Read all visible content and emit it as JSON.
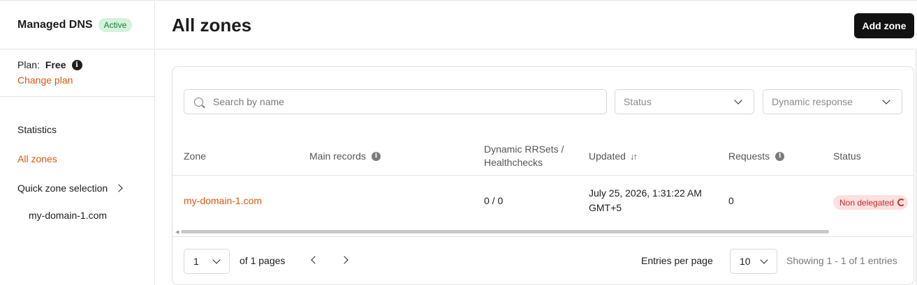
{
  "sidebar": {
    "title": "Managed DNS",
    "status_badge": "Active",
    "plan_label": "Plan:",
    "plan_value": "Free",
    "change_plan": "Change plan",
    "nav": [
      {
        "label": "Statistics"
      },
      {
        "label": "All zones"
      },
      {
        "label": "Quick zone selection"
      }
    ],
    "quick_zones": [
      "my-domain-1.com"
    ]
  },
  "header": {
    "title": "All zones",
    "add_button": "Add zone"
  },
  "filters": {
    "search_placeholder": "Search by name",
    "status_placeholder": "Status",
    "dynamic_placeholder": "Dynamic response"
  },
  "table": {
    "columns": {
      "zone": "Zone",
      "main_records": "Main records",
      "dynamic_line1": "Dynamic RRSets /",
      "dynamic_line2": "Healthchecks",
      "updated": "Updated",
      "requests": "Requests",
      "status": "Status"
    },
    "rows": [
      {
        "zone": "my-domain-1.com",
        "main_records": "",
        "dynamic": "0 / 0",
        "updated_line1": "July 25, 2026, 1:31:22 AM",
        "updated_line2": "GMT+5",
        "requests": "0",
        "status": "Non delegated"
      }
    ]
  },
  "pagination": {
    "page": "1",
    "of_pages": "of 1 pages",
    "entries_label": "Entries per page",
    "entries_value": "10",
    "showing": "Showing 1 - 1 of 1 entries"
  },
  "colors": {
    "accent": "#e0560f",
    "active_badge_bg": "#d3f3dc",
    "non_delegated_bg": "#fde0df"
  }
}
